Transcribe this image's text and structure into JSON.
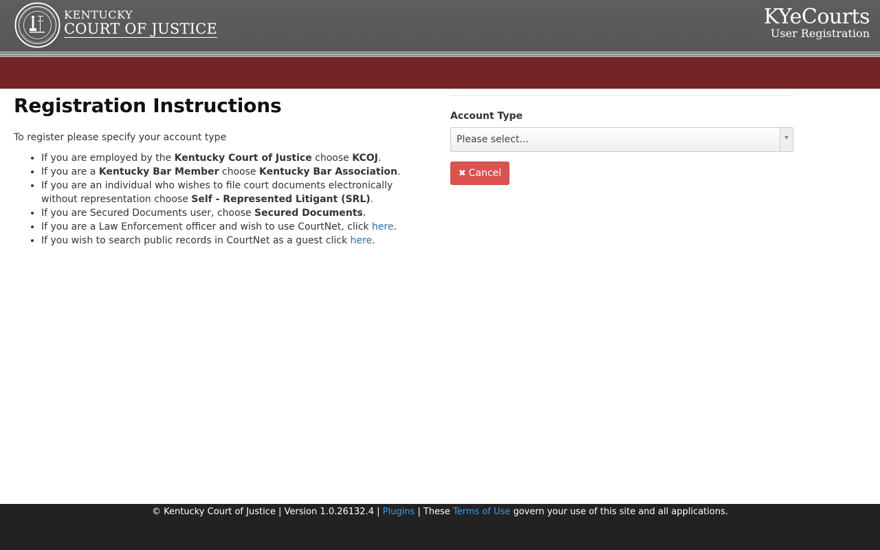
{
  "header": {
    "brand_small": "KENTUCKY",
    "brand_large": "COURT OF JUSTICE",
    "app_title": "KYeCourts",
    "app_subtitle": "User Registration"
  },
  "instructions": {
    "title": "Registration Instructions",
    "intro": "To register please specify your account type",
    "items": [
      {
        "pre": "If you are employed by the ",
        "b1": "Kentucky Court of Justice",
        "mid": " choose ",
        "b2": "KCOJ",
        "post": "."
      },
      {
        "pre": "If you are a ",
        "b1": "Kentucky Bar Member",
        "mid": " choose ",
        "b2": "Kentucky Bar Association",
        "post": "."
      },
      {
        "pre": "If you are an individual who wishes to file court documents electronically without representation choose ",
        "b1": "Self - Represented Litigant (SRL)",
        "post": "."
      },
      {
        "pre": "If you are Secured Documents user, choose ",
        "b1": "Secured Documents",
        "post": "."
      },
      {
        "pre": "If you are a Law Enforcement officer and wish to use CourtNet, click ",
        "link": "here",
        "post": "."
      },
      {
        "pre": "If you wish to search public records in CourtNet as a guest click ",
        "link": "here",
        "post": "."
      }
    ]
  },
  "form": {
    "account_type_label": "Account Type",
    "account_type_value": "Please select...",
    "cancel_label": "Cancel"
  },
  "footer": {
    "prefix": "© Kentucky Court of Justice | Version 1.0.26132.4 | ",
    "plugins_link": "Plugins",
    "middle": " | These ",
    "terms_link": "Terms of Use",
    "suffix": " govern your use of this site and all applications."
  },
  "colors": {
    "header_bg": "#5b5b59",
    "brand_red": "#722427",
    "cancel_red": "#d9534f",
    "link_blue": "#2a6faa",
    "footer_bg": "#222222",
    "footer_link": "#3d9be9"
  },
  "icons": {
    "seal": "kentucky-court-seal-icon",
    "cancel": "times-icon",
    "dropdown": "caret-down-icon"
  }
}
